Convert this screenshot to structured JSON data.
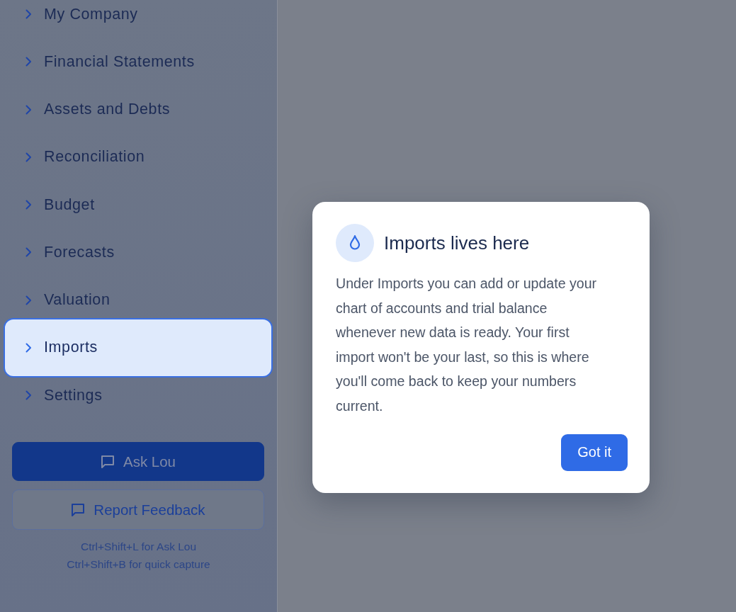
{
  "sidebar": {
    "nav_items": [
      {
        "label": "My Company",
        "selected": false
      },
      {
        "label": "Financial Statements",
        "selected": false
      },
      {
        "label": "Assets and Debts",
        "selected": false
      },
      {
        "label": "Reconciliation",
        "selected": false
      },
      {
        "label": "Budget",
        "selected": false
      },
      {
        "label": "Forecasts",
        "selected": false
      },
      {
        "label": "Valuation",
        "selected": false
      },
      {
        "label": "Imports",
        "selected": true
      },
      {
        "label": "Settings",
        "selected": false
      }
    ],
    "buttons": [
      {
        "label": "Ask Lou",
        "kind": "primary"
      },
      {
        "label": "Report Feedback",
        "kind": "secondary"
      }
    ],
    "shortcut_hints": [
      "Ctrl+Shift+L for Ask Lou",
      "Ctrl+Shift+B for quick capture"
    ]
  },
  "dialog": {
    "title": "Imports lives here",
    "body": "Under Imports you can add or update your chart of accounts and trial balance whenever new data is ready. Your first import won't be your last, so this is where you'll come back to keep your numbers current.",
    "button": "Got it"
  }
}
